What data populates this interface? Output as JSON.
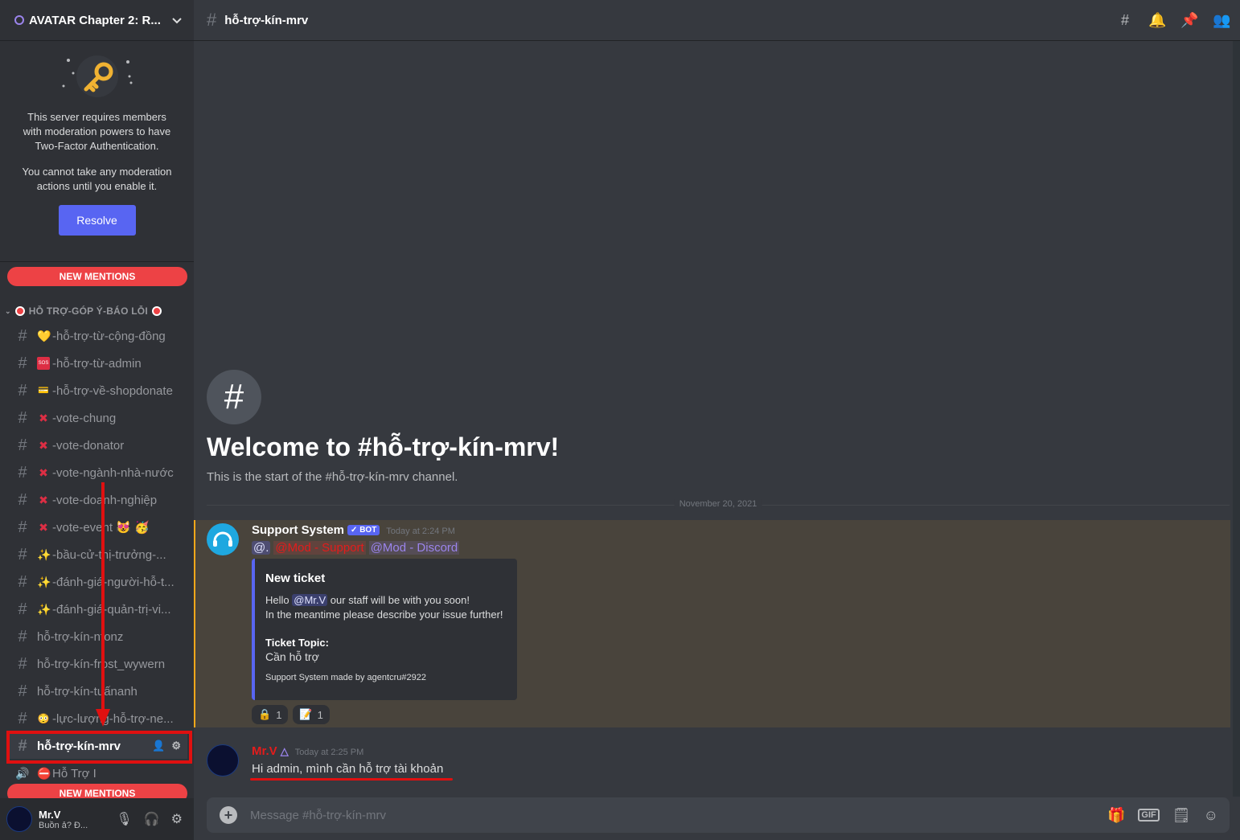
{
  "server": {
    "name": "AVATAR Chapter 2: R..."
  },
  "twofa": {
    "line1": "This server requires members with moderation powers to have Two-Factor Authentication.",
    "line2": "You cannot take any moderation actions until you enable it.",
    "resolve_label": "Resolve"
  },
  "new_mentions_label": "NEW MENTIONS",
  "category": {
    "label": "HỖ TRỢ-GÓP Ý-BÁO LỖI"
  },
  "channels": [
    {
      "label": "-hỗ-trợ-từ-cộng-đồng",
      "emoji": "💛"
    },
    {
      "label": "-hỗ-trợ-từ-admin",
      "emoji": "SOS"
    },
    {
      "label": "-hỗ-trợ-về-shopdonate",
      "emoji": "💳"
    },
    {
      "label": "-vote-chung",
      "emoji": "✖"
    },
    {
      "label": "-vote-donator",
      "emoji": "✖"
    },
    {
      "label": "-vote-ngành-nhà-nước",
      "emoji": "✖"
    },
    {
      "label": "-vote-doanh-nghiệp",
      "emoji": "✖"
    },
    {
      "label": "-vote-event 😻 🥳",
      "emoji": "✖"
    },
    {
      "label": "-bầu-cử-thị-trưởng-...",
      "emoji": "✨"
    },
    {
      "label": "-đánh-giá-người-hỗ-t...",
      "emoji": "✨"
    },
    {
      "label": "-đánh-giá-quản-trị-vi...",
      "emoji": "✨"
    },
    {
      "label": "hỗ-trợ-kín-nfonz",
      "emoji": ""
    },
    {
      "label": "hỗ-trợ-kín-frost_wywern",
      "emoji": ""
    },
    {
      "label": "hỗ-trợ-kín-tuấnanh",
      "emoji": ""
    },
    {
      "label": "-lực-lượng-hỗ-trợ-ne...",
      "emoji": "😳"
    },
    {
      "label": "hỗ-trợ-kín-mrv",
      "emoji": ""
    },
    {
      "label": "Hỗ Trợ I",
      "emoji": "⛔"
    }
  ],
  "user_panel": {
    "username": "Mr.V",
    "status": "Buồn ả? Đ..."
  },
  "topbar": {
    "channel": "hỗ-trợ-kín-mrv"
  },
  "welcome": {
    "title": "Welcome to #hỗ-trợ-kín-mrv!",
    "subtitle": "This is the start of the #hỗ-trợ-kín-mrv channel."
  },
  "date_divider": "November 20, 2021",
  "message1": {
    "author": "Support System",
    "bot_tag": "✓ BOT",
    "time": "Today at 2:24 PM",
    "mention_at": "@.",
    "mention_mod_support": "@Mod - Support",
    "mention_mod_discord": "@Mod - Discord",
    "embed": {
      "title": "New ticket",
      "desc_hello": "Hello",
      "desc_user": "@Mr.V",
      "desc_rest": "our staff will be with you soon!",
      "desc_line2": "In the meantime please describe your issue further!",
      "field_name": "Ticket Topic:",
      "field_value": "Cần hỗ trợ",
      "footer": "Support System made by agentcru#2922"
    },
    "reactions": [
      {
        "emoji": "🔒",
        "count": "1"
      },
      {
        "emoji": "📝",
        "count": "1"
      }
    ]
  },
  "message2": {
    "author": "Mr.V",
    "time": "Today at 2:25 PM",
    "text": "Hi admin, mình cần hỗ trợ tài khoản"
  },
  "composer": {
    "placeholder": "Message #hỗ-trợ-kín-mrv"
  },
  "colors": {
    "accent": "#5865f2",
    "mention": "#ed4245",
    "highlight": "#faa81a",
    "annotation": "#e01010"
  }
}
